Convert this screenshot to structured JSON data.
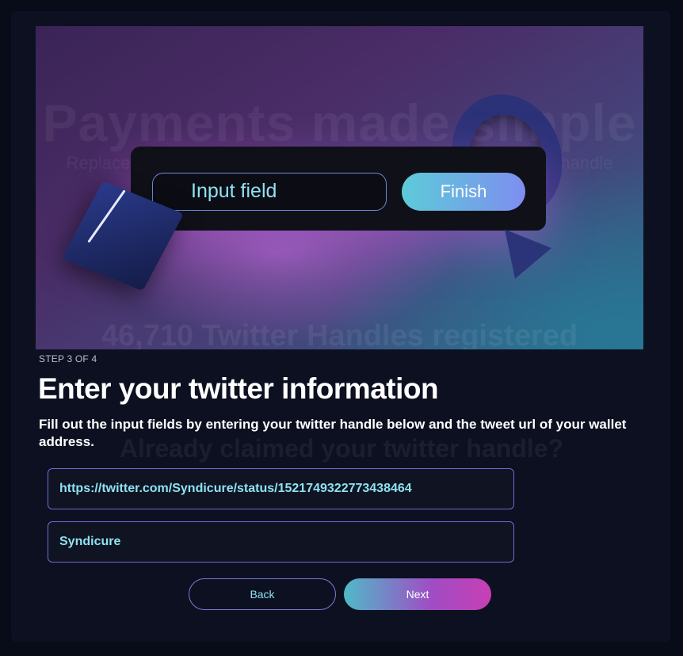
{
  "hero": {
    "ghost_title": "Payments made simple",
    "ghost_subtitle": "Replace your unreadable crypto wallet address with your twitter handle",
    "ghost_count": "46,710  Twitter Handles registered",
    "mock_input_label": "Input field",
    "mock_button_label": "Finish"
  },
  "background": {
    "ghost_question": "Already claimed your twitter handle?"
  },
  "step": {
    "label": "STEP 3 OF 4",
    "title": "Enter your twitter information",
    "description": "Fill out the input fields by entering your twitter handle below and the tweet url of your wallet address."
  },
  "form": {
    "tweet_url_value": "https://twitter.com/Syndicure/status/1521749322773438464",
    "handle_value": "Syndicure"
  },
  "buttons": {
    "back": "Back",
    "next": "Next"
  },
  "colors": {
    "accent_cyan": "#8fe2f0",
    "border_purple": "#6d6cd6",
    "next_gradient_start": "#4fb9c8",
    "next_gradient_end": "#c83fb4",
    "background": "#080b18"
  }
}
